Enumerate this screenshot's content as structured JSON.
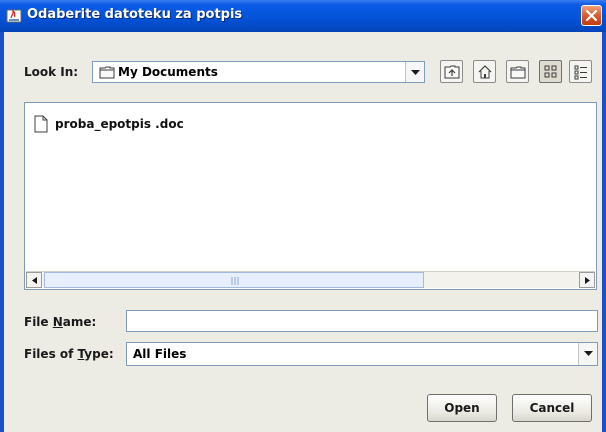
{
  "window": {
    "title": "Odaberite datoteku za potpis"
  },
  "look_in": {
    "label": "Look In:",
    "label_mnemonic": "I",
    "folder": "My Documents"
  },
  "toolbar": {
    "buttons": [
      {
        "icon": "up-one-level-icon"
      },
      {
        "icon": "home-icon"
      },
      {
        "icon": "new-folder-icon"
      },
      {
        "icon": "list-view-icon",
        "pressed": true
      },
      {
        "icon": "details-view-icon"
      }
    ]
  },
  "files": [
    {
      "name": "proba_epotpis .doc",
      "icon": "document-icon"
    }
  ],
  "file_name": {
    "label_pre": "File ",
    "label_mnemonic": "N",
    "label_post": "ame:",
    "value": ""
  },
  "file_type": {
    "label_pre": "Files of ",
    "label_mnemonic": "T",
    "label_post": "ype:",
    "selected": "All Files"
  },
  "buttons": {
    "open": "Open",
    "cancel": "Cancel"
  },
  "colors": {
    "titlebar": "#0352d6",
    "dialog_bg": "#ecebe4",
    "field_border": "#7f9db9",
    "close_button": "#dc5a2e"
  }
}
